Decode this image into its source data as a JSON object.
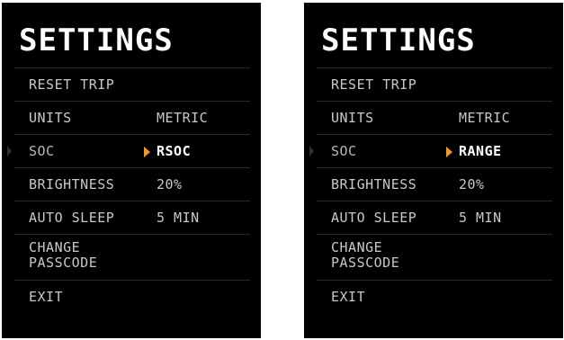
{
  "colors": {
    "accent": "#f29b18",
    "background": "#000000",
    "text": "#d6d6d6"
  },
  "screens": [
    {
      "title": "SETTINGS",
      "items": [
        {
          "label": "RESET TRIP",
          "value": ""
        },
        {
          "label": "UNITS",
          "value": "METRIC"
        },
        {
          "label": "SOC",
          "value": "RSOC"
        },
        {
          "label": "BRIGHTNESS",
          "value": "20%"
        },
        {
          "label": "AUTO SLEEP",
          "value": "5 MIN"
        },
        {
          "label": "CHANGE\nPASSCODE",
          "value": ""
        },
        {
          "label": "EXIT",
          "value": ""
        }
      ]
    },
    {
      "title": "SETTINGS",
      "items": [
        {
          "label": "RESET TRIP",
          "value": ""
        },
        {
          "label": "UNITS",
          "value": "METRIC"
        },
        {
          "label": "SOC",
          "value": "RANGE"
        },
        {
          "label": "BRIGHTNESS",
          "value": "20%"
        },
        {
          "label": "AUTO SLEEP",
          "value": "5 MIN"
        },
        {
          "label": "CHANGE\nPASSCODE",
          "value": ""
        },
        {
          "label": "EXIT",
          "value": ""
        }
      ]
    }
  ]
}
